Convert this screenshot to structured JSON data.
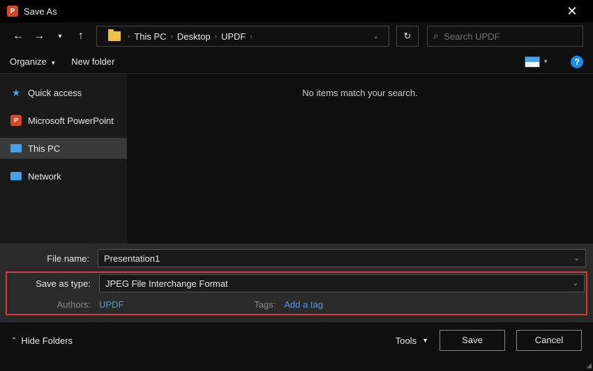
{
  "titlebar": {
    "title": "Save As"
  },
  "breadcrumb": {
    "items": [
      "This PC",
      "Desktop",
      "UPDF"
    ]
  },
  "search": {
    "placeholder": "Search UPDF"
  },
  "toolbar": {
    "organize": "Organize",
    "newfolder": "New folder"
  },
  "sidebar": {
    "items": [
      {
        "label": "Quick access"
      },
      {
        "label": "Microsoft PowerPoint"
      },
      {
        "label": "This PC"
      },
      {
        "label": "Network"
      }
    ]
  },
  "content": {
    "empty": "No items match your search."
  },
  "form": {
    "filename_label": "File name:",
    "filename_value": "Presentation1",
    "saveastype_label": "Save as type:",
    "saveastype_value": "JPEG File Interchange Format",
    "authors_label": "Authors:",
    "authors_value": "UPDF",
    "tags_label": "Tags:",
    "tags_value": "Add a tag"
  },
  "footer": {
    "hidefolders": "Hide Folders",
    "tools": "Tools",
    "save": "Save",
    "cancel": "Cancel"
  }
}
